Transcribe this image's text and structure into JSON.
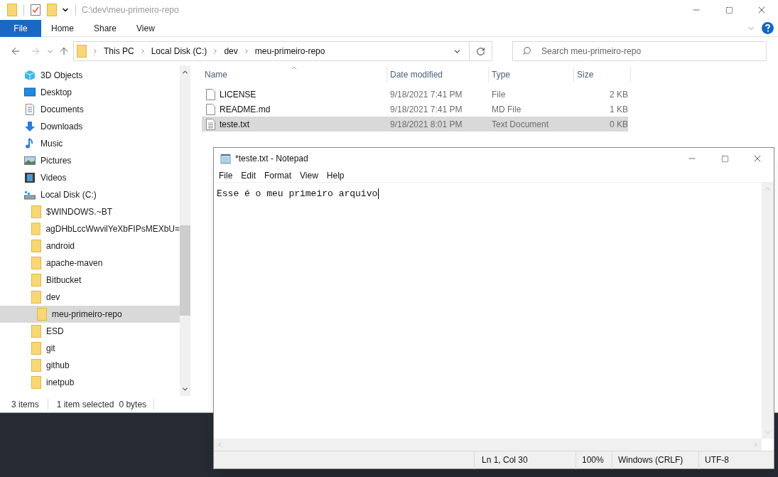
{
  "explorer": {
    "title": "C:\\dev\\meu-primeiro-repo",
    "file_button": "File",
    "ribbon_tabs": [
      "Home",
      "Share",
      "View"
    ],
    "breadcrumbs": [
      "This PC",
      "Local Disk (C:)",
      "dev",
      "meu-primeiro-repo"
    ],
    "search": {
      "placeholder": "Search meu-primeiro-repo"
    },
    "sidebar": {
      "items": [
        {
          "label": "3D Objects",
          "kind": "objects",
          "selected": false
        },
        {
          "label": "Desktop",
          "kind": "desktop",
          "selected": false
        },
        {
          "label": "Documents",
          "kind": "documents",
          "selected": false
        },
        {
          "label": "Downloads",
          "kind": "downloads",
          "selected": false
        },
        {
          "label": "Music",
          "kind": "music",
          "selected": false
        },
        {
          "label": "Pictures",
          "kind": "pictures",
          "selected": false
        },
        {
          "label": "Videos",
          "kind": "videos",
          "selected": false
        },
        {
          "label": "Local Disk (C:)",
          "kind": "drive",
          "selected": false,
          "children": [
            {
              "label": "$WINDOWS.~BT",
              "kind": "folder",
              "selected": false
            },
            {
              "label": "agDHbLccWwvilYeXbFIPsMEXbU=",
              "kind": "folder",
              "selected": false
            },
            {
              "label": "android",
              "kind": "folder",
              "selected": false
            },
            {
              "label": "apache-maven",
              "kind": "folder",
              "selected": false
            },
            {
              "label": "Bitbucket",
              "kind": "folder",
              "selected": false
            },
            {
              "label": "dev",
              "kind": "folder",
              "selected": false,
              "children": [
                {
                  "label": "meu-primeiro-repo",
                  "kind": "folder",
                  "selected": true
                }
              ]
            },
            {
              "label": "ESD",
              "kind": "folder",
              "selected": false
            },
            {
              "label": "git",
              "kind": "folder",
              "selected": false
            },
            {
              "label": "github",
              "kind": "folder",
              "selected": false
            },
            {
              "label": "inetpub",
              "kind": "folder",
              "selected": false
            }
          ]
        }
      ]
    },
    "table": {
      "columns": [
        {
          "label": "Name",
          "sorted": true
        },
        {
          "label": "Date modified",
          "sorted": false
        },
        {
          "label": "Type",
          "sorted": false
        },
        {
          "label": "Size",
          "sorted": false
        }
      ],
      "rows": [
        {
          "name": "LICENSE",
          "date": "9/18/2021 7:41 PM",
          "type": "File",
          "size": "2 KB",
          "kind": "blank",
          "selected": false
        },
        {
          "name": "README.md",
          "date": "9/18/2021 7:41 PM",
          "type": "MD File",
          "size": "1 KB",
          "kind": "blank",
          "selected": false
        },
        {
          "name": "teste.txt",
          "date": "9/18/2021 8:01 PM",
          "type": "Text Document",
          "size": "0 KB",
          "kind": "text",
          "selected": true
        }
      ]
    },
    "status_bar": [
      "3 items",
      "1 item selected",
      "0 bytes"
    ]
  },
  "notepad": {
    "title": "*teste.txt - Notepad",
    "menu": [
      "File",
      "Edit",
      "Format",
      "View",
      "Help"
    ],
    "text": "Esse é o meu primeiro arquivo",
    "status_bar": [
      "Ln 1, Col 30",
      "100%",
      "Windows (CRLF)",
      "UTF-8"
    ]
  }
}
